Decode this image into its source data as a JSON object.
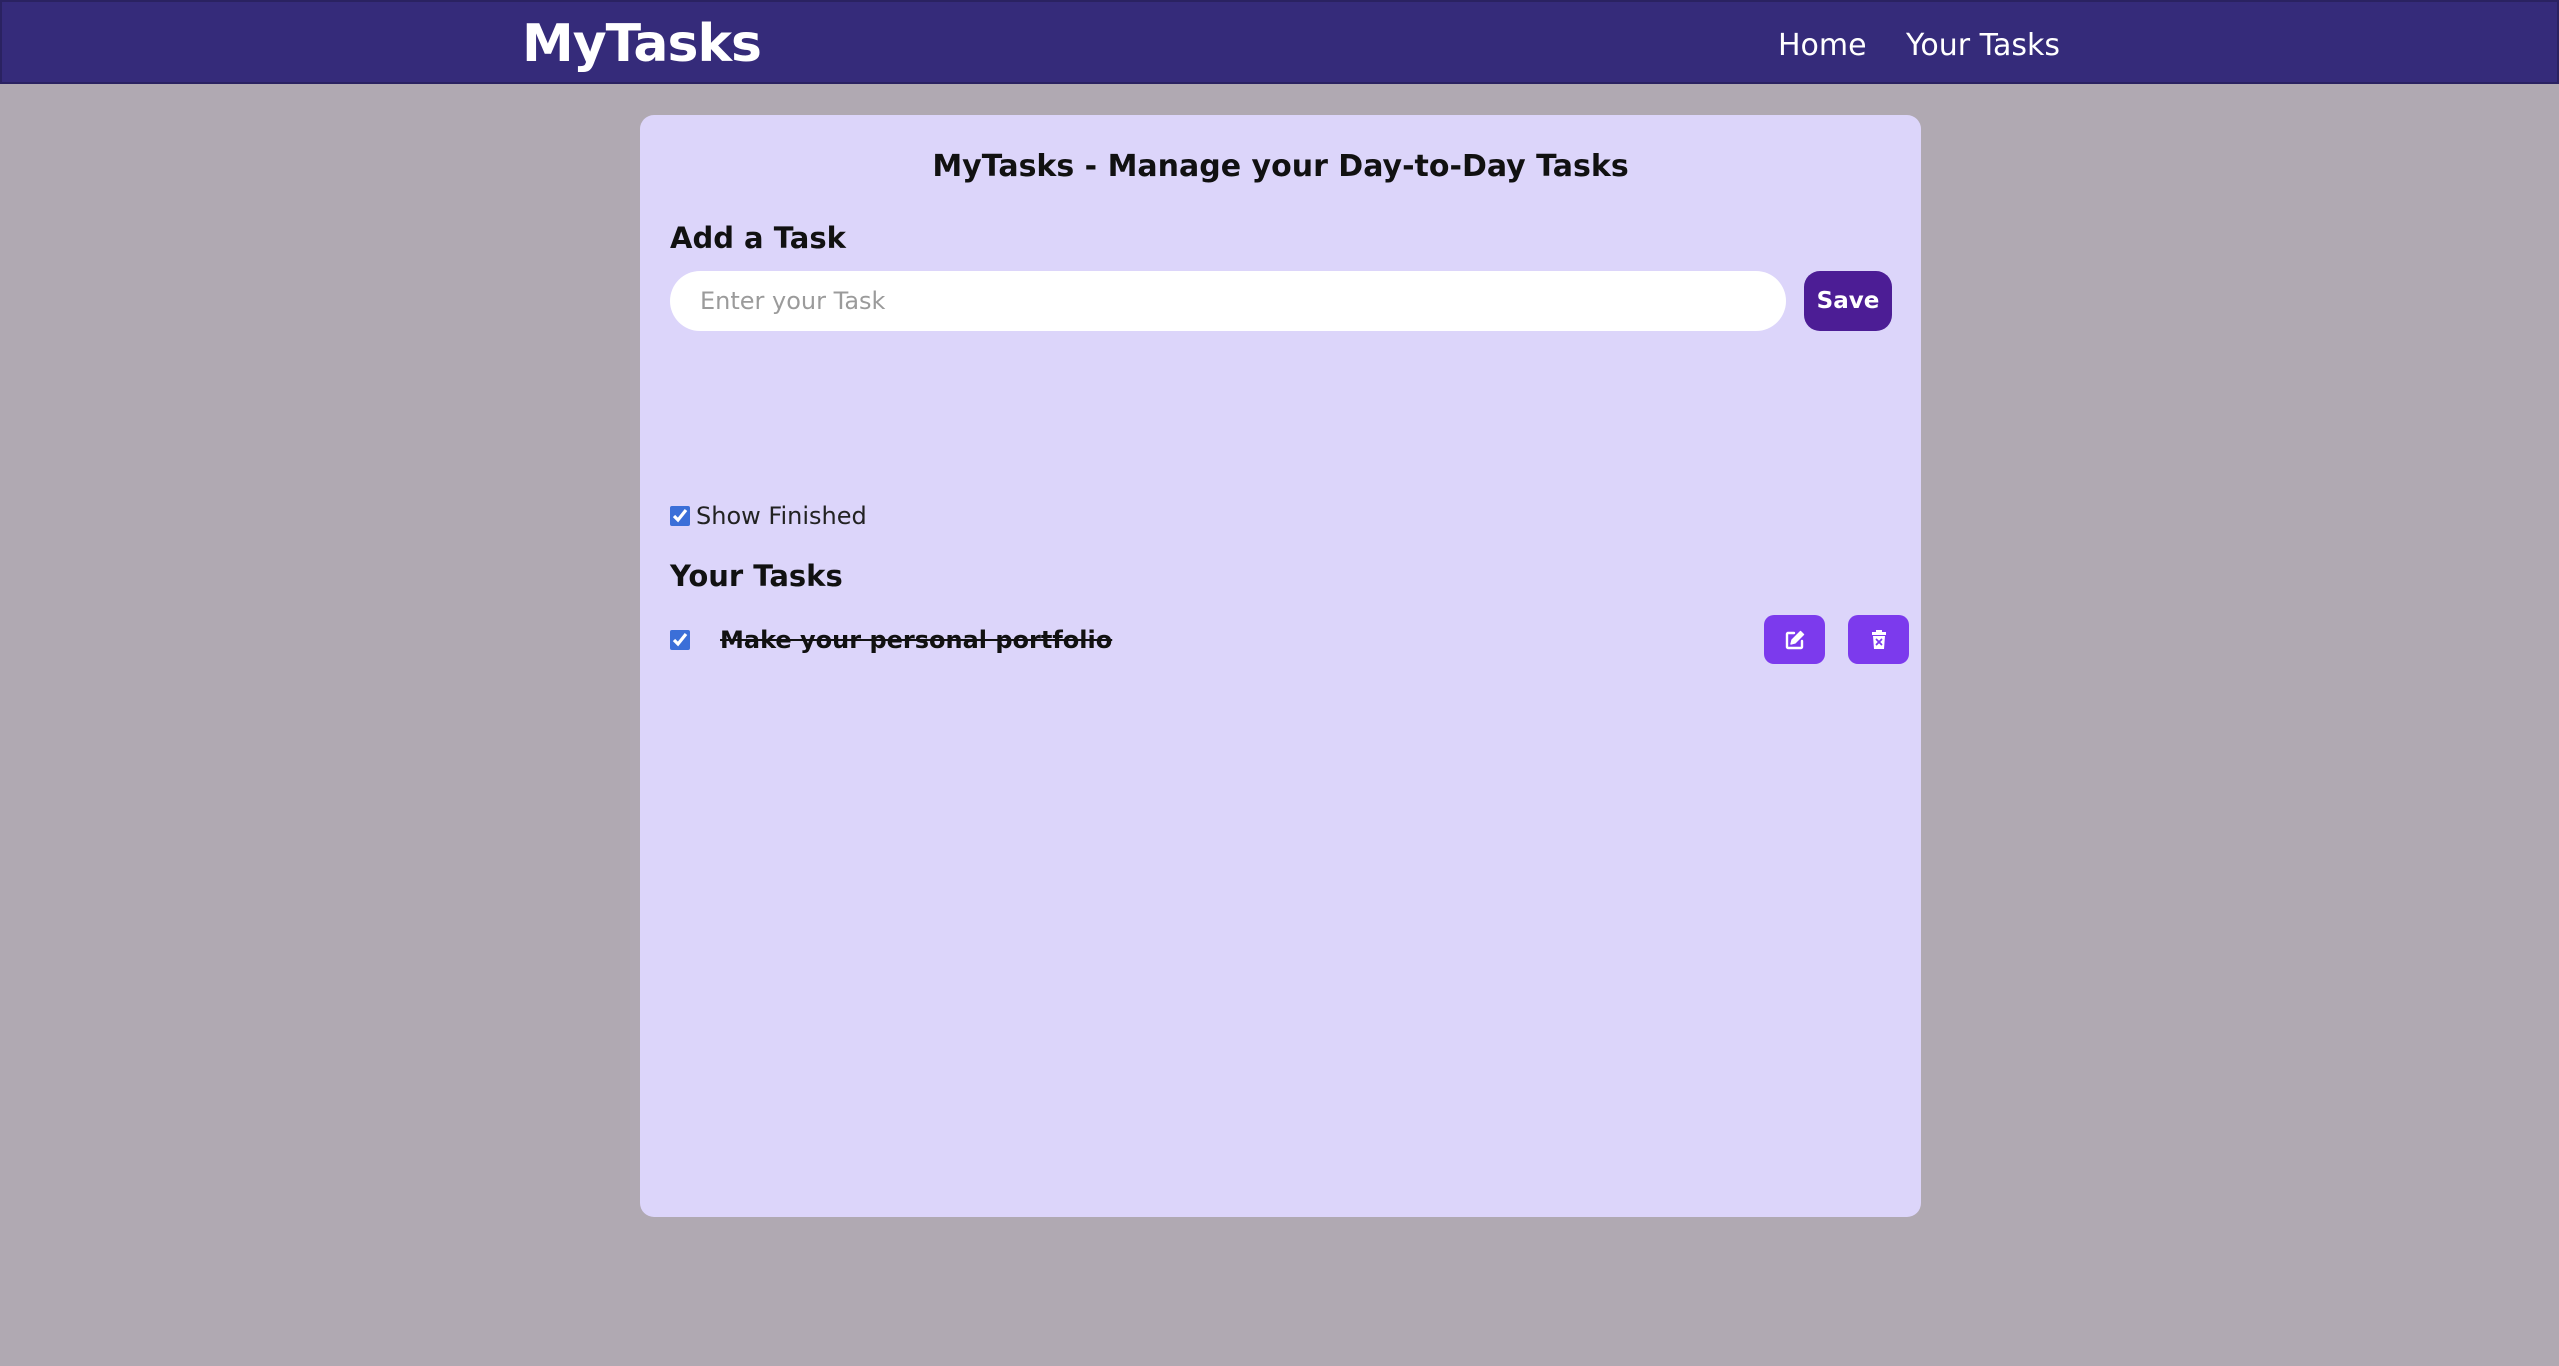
{
  "navbar": {
    "brand": "MyTasks",
    "links": [
      {
        "label": "Home"
      },
      {
        "label": "Your Tasks"
      }
    ]
  },
  "card": {
    "title": "MyTasks - Manage your Day-to-Day Tasks",
    "add_section_title": "Add a Task",
    "input": {
      "placeholder": "Enter your Task",
      "value": ""
    },
    "save_label": "Save",
    "show_finished": {
      "label": "Show Finished",
      "checked": true
    },
    "list_title": "Your Tasks",
    "tasks": [
      {
        "text": "Make your personal portfolio",
        "done": true
      }
    ]
  },
  "icons": {
    "edit": "edit-icon",
    "delete": "trash-icon"
  },
  "colors": {
    "navbar": "#352b7a",
    "background": "#b0a9b2",
    "card": "#dcd5fa",
    "save_button": "#4c1d95",
    "icon_button": "#7c3aed"
  }
}
